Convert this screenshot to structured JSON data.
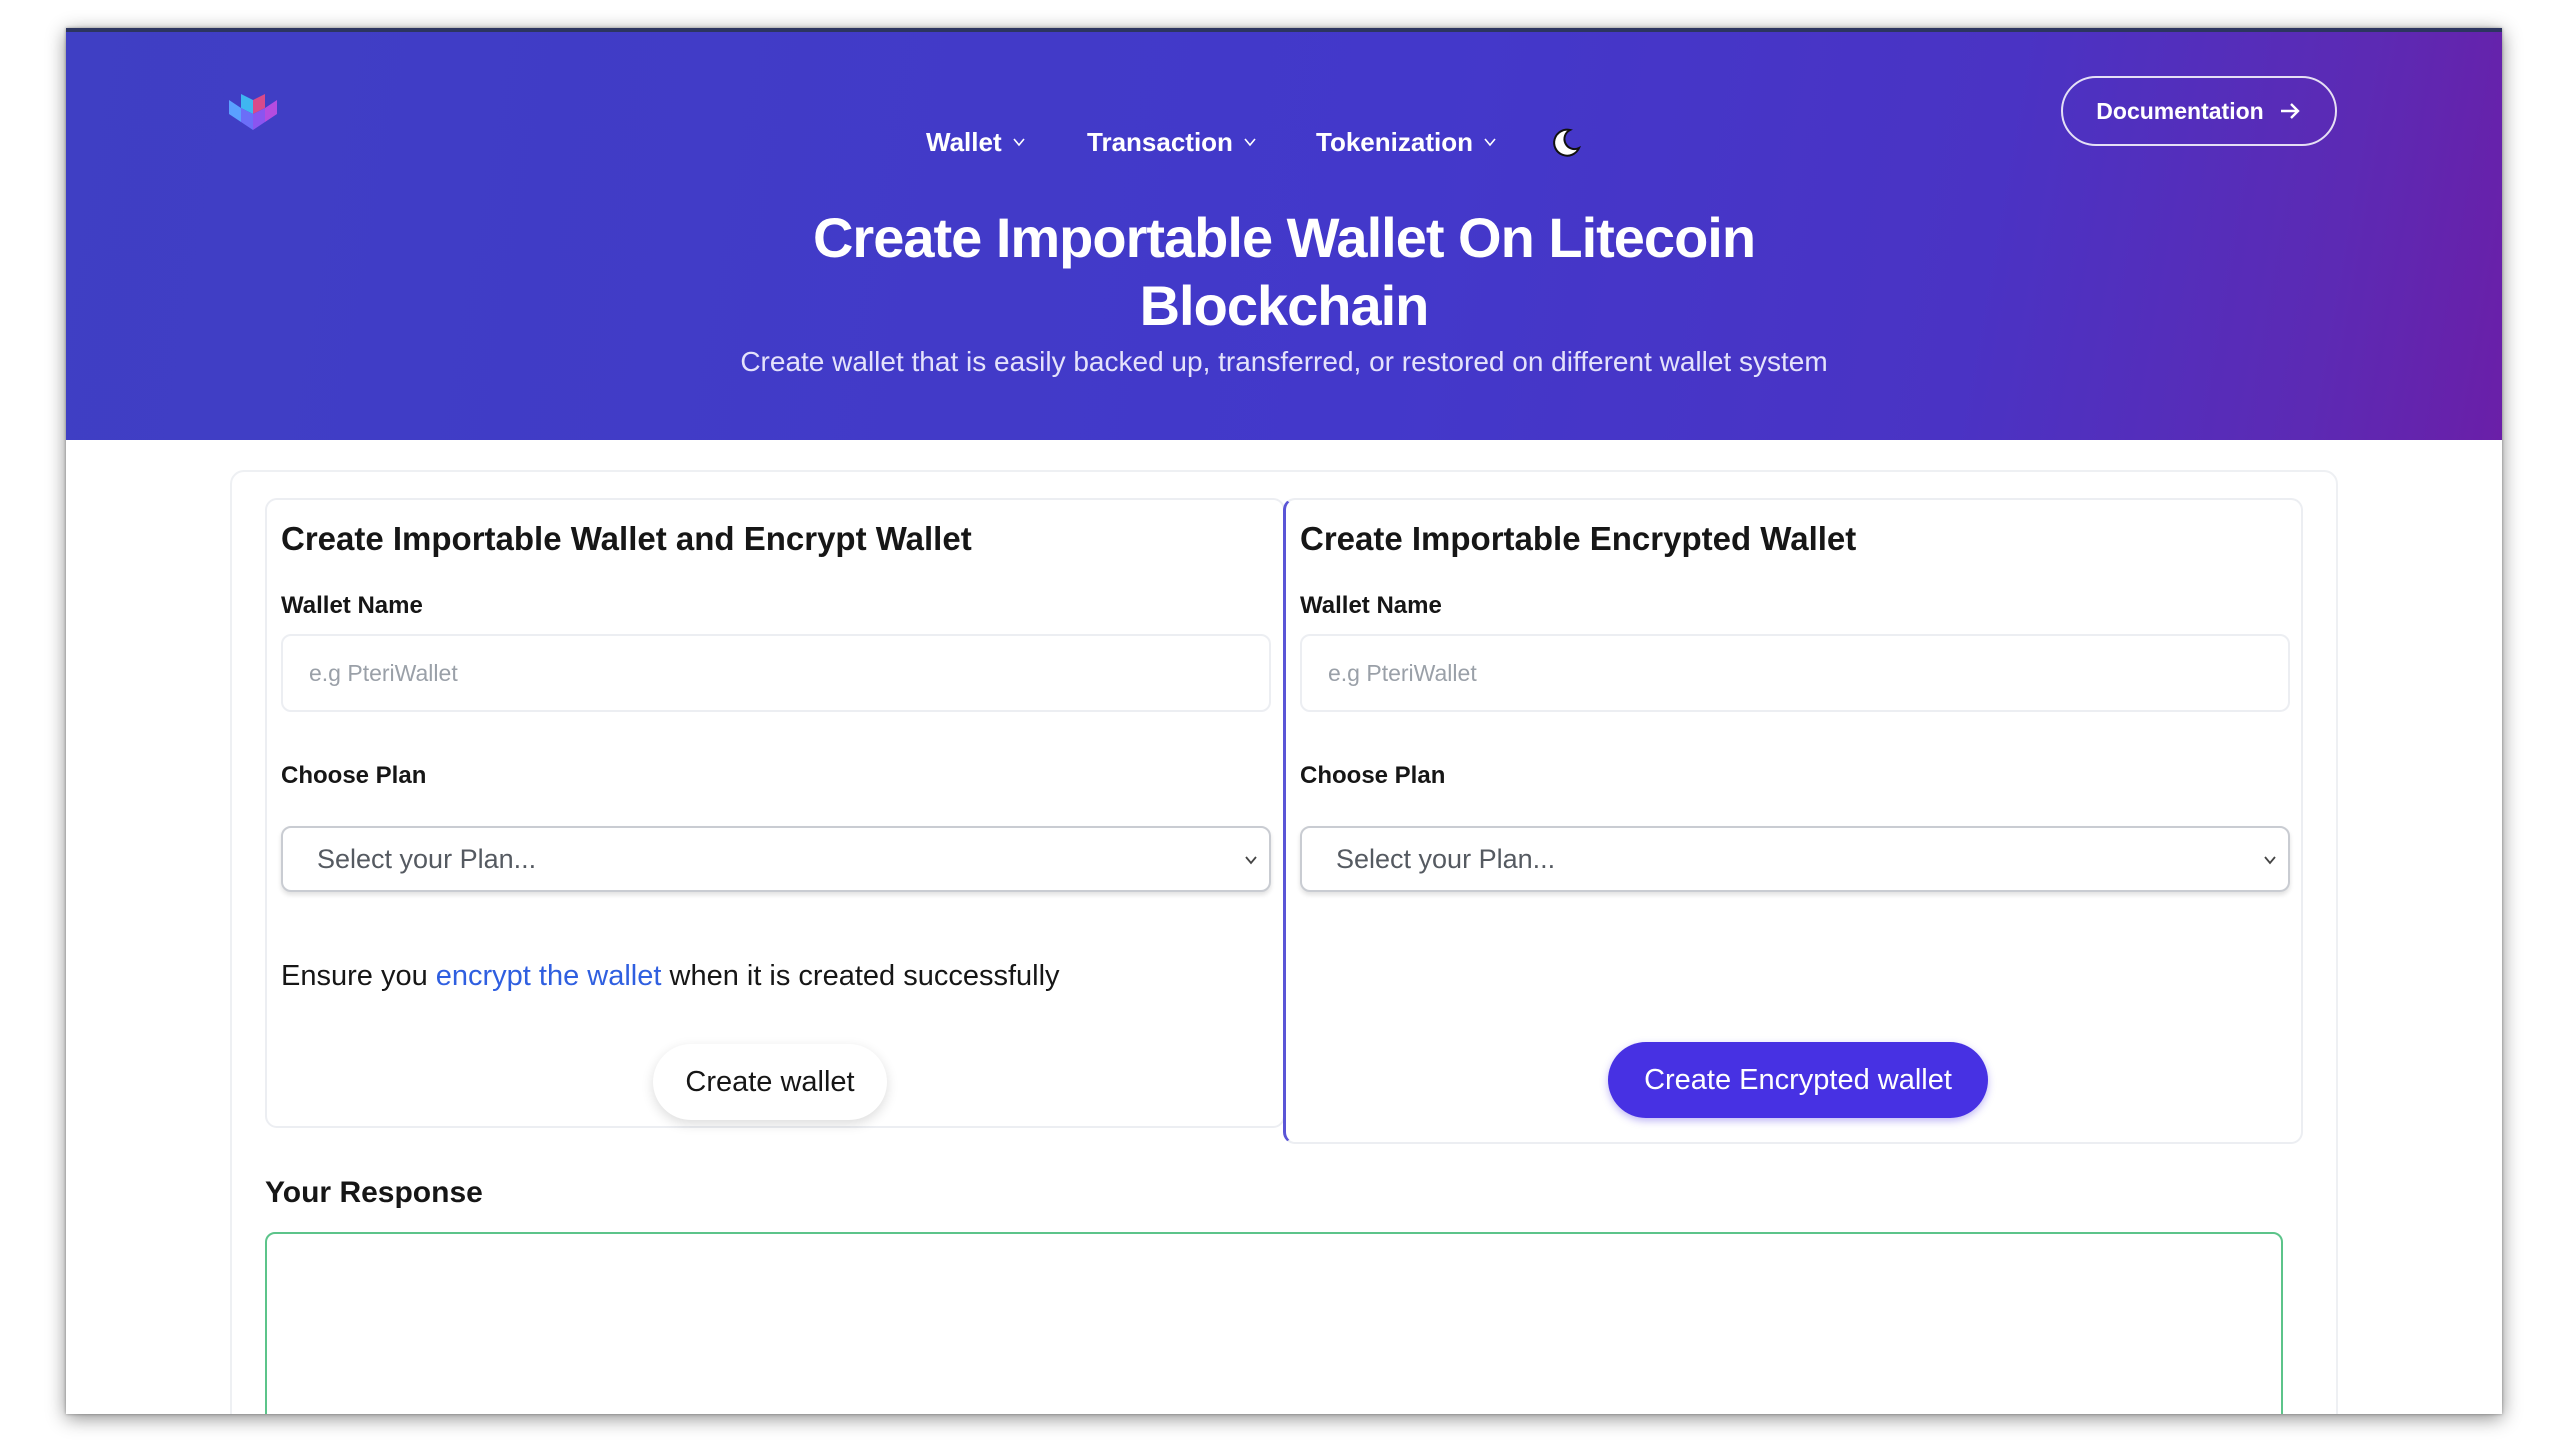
{
  "nav": {
    "items": [
      {
        "label": "Wallet"
      },
      {
        "label": "Transaction"
      },
      {
        "label": "Tokenization"
      }
    ],
    "documentation_label": "Documentation"
  },
  "hero": {
    "title_line1": "Create Importable Wallet On Litecoin",
    "title_line2": "Blockchain",
    "subtitle": "Create wallet that is easily backed up, transferred, or restored on different wallet system"
  },
  "left_panel": {
    "title": "Create Importable Wallet and Encrypt Wallet",
    "wallet_name_label": "Wallet Name",
    "wallet_name_placeholder": "e.g PteriWallet",
    "wallet_name_value": "",
    "choose_plan_label": "Choose Plan",
    "plan_placeholder": "Select your Plan...",
    "note_before": "Ensure you ",
    "note_link": "encrypt the wallet",
    "note_after": " when it is created successfully",
    "button_label": "Create wallet"
  },
  "right_panel": {
    "title": "Create Importable Encrypted Wallet",
    "wallet_name_label": "Wallet Name",
    "wallet_name_placeholder": "e.g PteriWallet",
    "wallet_name_value": "",
    "choose_plan_label": "Choose Plan",
    "plan_placeholder": "Select your Plan...",
    "button_label": "Create Encrypted wallet"
  },
  "response": {
    "label": "Your Response",
    "value": ""
  },
  "colors": {
    "hero_start": "#3f3fc4",
    "hero_end": "#6a1fa8",
    "primary_button": "#4731e3",
    "link": "#2f5fe0",
    "response_border": "#5cc48a"
  },
  "icons": {
    "logo": "cube-logo-icon",
    "theme_toggle": "moon-icon",
    "documentation": "arrow-right-icon",
    "dropdown": "chevron-down-icon"
  }
}
